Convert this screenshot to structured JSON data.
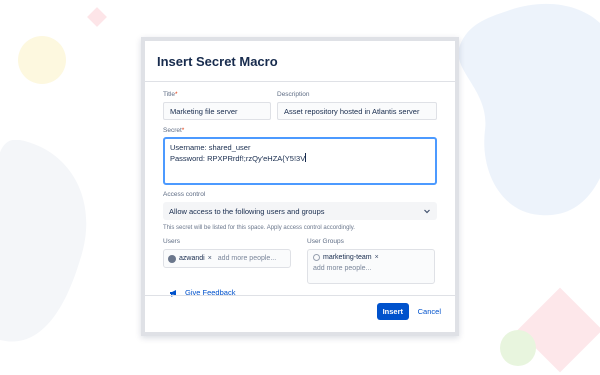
{
  "colors": {
    "primary": "#0052cc",
    "required": "#de350b",
    "focus": "#4c9aff"
  },
  "dialog": {
    "title": "Insert Secret Macro",
    "title_field": {
      "label": "Title",
      "value": "Marketing file server"
    },
    "description_field": {
      "label": "Description",
      "value": "Asset repository hosted in Atlantis server"
    },
    "secret_field": {
      "label": "Secret",
      "line1": "Username: shared_user",
      "line2": "Password: RPXPRrdf!;rzQy'eHZA{Y5!3V"
    },
    "access_control": {
      "label": "Access control",
      "selected": "Allow access to the following users and groups",
      "helper": "This secret will be listed for this space. Apply access control accordingly."
    },
    "users": {
      "label": "Users",
      "chips": [
        {
          "name": "azwandi",
          "remove": "×"
        }
      ],
      "placeholder": "add more people..."
    },
    "user_groups": {
      "label": "User Groups",
      "chips": [
        {
          "name": "marketing-team",
          "remove": "×"
        }
      ],
      "placeholder": "add more people..."
    },
    "feedback_link": "Give Feedback",
    "buttons": {
      "insert": "Insert",
      "cancel": "Cancel"
    },
    "icons": {
      "feedback": "megaphone-icon",
      "dropdown": "chevron-down-icon",
      "user": "user-avatar-icon",
      "group": "group-icon"
    }
  }
}
